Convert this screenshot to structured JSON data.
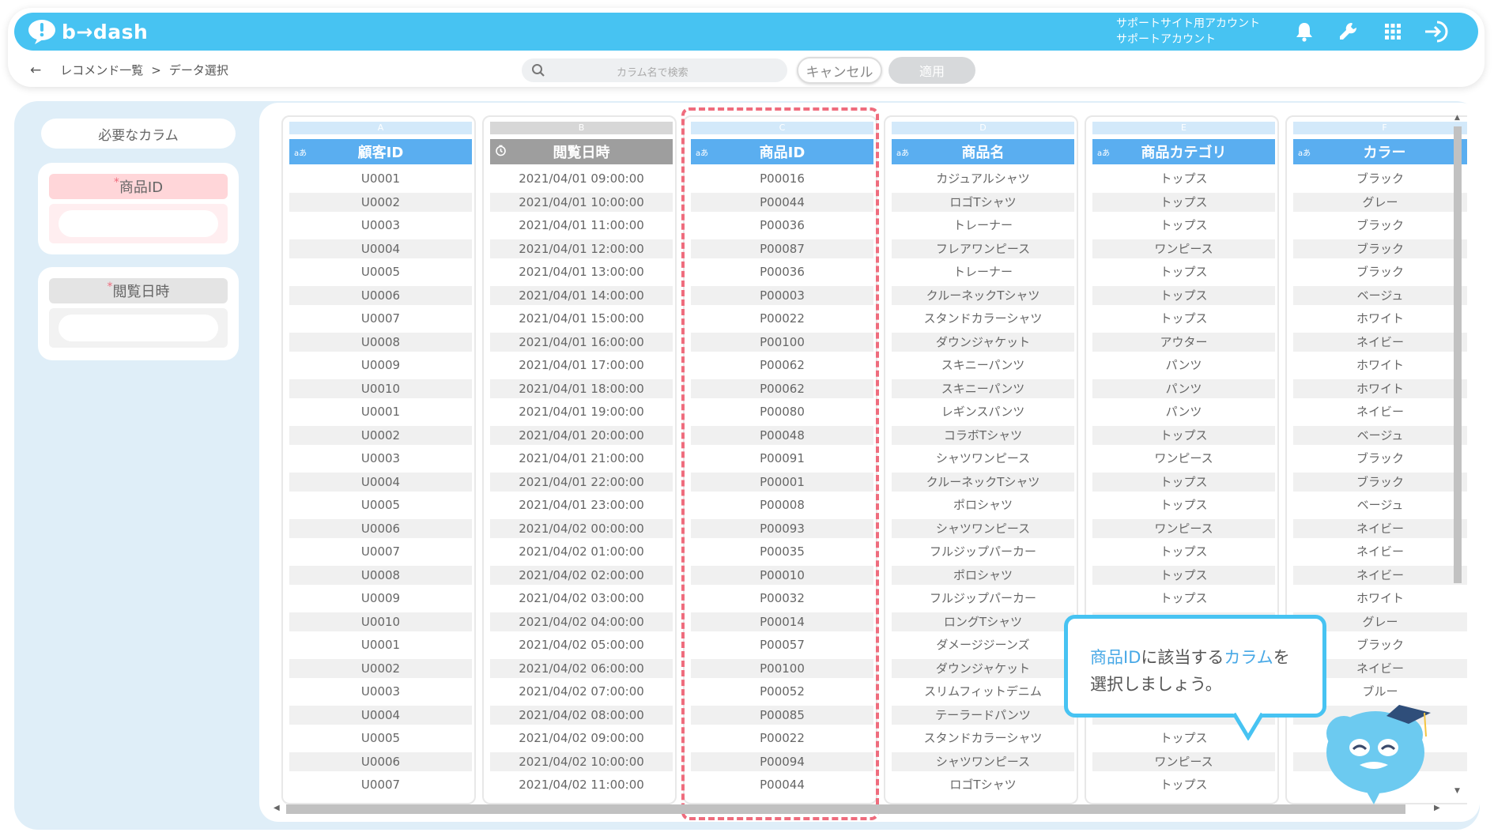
{
  "app": {
    "logo_text": "b→dash",
    "account_line1": "サポートサイト用アカウント",
    "account_line2": "サポートアカウント"
  },
  "toolbar_icons": [
    "bell-icon",
    "wrench-icon",
    "grid-icon",
    "logout-icon"
  ],
  "breadcrumb": {
    "parent": "レコメンド一覧",
    "separator": ">",
    "current": "データ選択"
  },
  "search": {
    "placeholder": "カラム名で検索"
  },
  "buttons": {
    "cancel": "キャンセル",
    "apply": "適用"
  },
  "sidebar": {
    "title": "必要なカラム",
    "required": [
      {
        "label": "商品ID",
        "asterisk": "*",
        "color": "#ffd6d9",
        "slot_color": "#ffeef0",
        "label_color": "#666"
      },
      {
        "label": "閲覧日時",
        "asterisk": "*",
        "color": "#e4e4e4",
        "slot_color": "#f2f2f2",
        "label_color": "#666"
      }
    ]
  },
  "colors": {
    "accent": "#47c3f2",
    "header_blue": "#5aaef0",
    "header_gray": "#9e9e9e",
    "highlight": "#ef6c7d"
  },
  "columns": [
    {
      "letter": "A",
      "name": "顧客ID",
      "type": "aあ",
      "header_color": "#5aaef0",
      "letter_color": "#d3e9fa",
      "values": [
        "U0001",
        "U0002",
        "U0003",
        "U0004",
        "U0005",
        "U0006",
        "U0007",
        "U0008",
        "U0009",
        "U0010",
        "U0001",
        "U0002",
        "U0003",
        "U0004",
        "U0005",
        "U0006",
        "U0007",
        "U0008",
        "U0009",
        "U0010",
        "U0001",
        "U0002",
        "U0003",
        "U0004",
        "U0005",
        "U0006",
        "U0007"
      ]
    },
    {
      "letter": "B",
      "name": "閲覧日時",
      "type": "clock",
      "header_color": "#9e9e9e",
      "letter_color": "#d7d7d7",
      "values": [
        "2021/04/01 09:00:00",
        "2021/04/01 10:00:00",
        "2021/04/01 11:00:00",
        "2021/04/01 12:00:00",
        "2021/04/01 13:00:00",
        "2021/04/01 14:00:00",
        "2021/04/01 15:00:00",
        "2021/04/01 16:00:00",
        "2021/04/01 17:00:00",
        "2021/04/01 18:00:00",
        "2021/04/01 19:00:00",
        "2021/04/01 20:00:00",
        "2021/04/01 21:00:00",
        "2021/04/01 22:00:00",
        "2021/04/01 23:00:00",
        "2021/04/02 00:00:00",
        "2021/04/02 01:00:00",
        "2021/04/02 02:00:00",
        "2021/04/02 03:00:00",
        "2021/04/02 04:00:00",
        "2021/04/02 05:00:00",
        "2021/04/02 06:00:00",
        "2021/04/02 07:00:00",
        "2021/04/02 08:00:00",
        "2021/04/02 09:00:00",
        "2021/04/02 10:00:00",
        "2021/04/02 11:00:00"
      ]
    },
    {
      "letter": "C",
      "name": "商品ID",
      "type": "aあ",
      "header_color": "#5aaef0",
      "letter_color": "#d3e9fa",
      "values": [
        "P00016",
        "P00044",
        "P00036",
        "P00087",
        "P00036",
        "P00003",
        "P00022",
        "P00100",
        "P00062",
        "P00062",
        "P00080",
        "P00048",
        "P00091",
        "P00001",
        "P00008",
        "P00093",
        "P00035",
        "P00010",
        "P00032",
        "P00014",
        "P00057",
        "P00100",
        "P00052",
        "P00085",
        "P00022",
        "P00094",
        "P00044"
      ]
    },
    {
      "letter": "D",
      "name": "商品名",
      "type": "aあ",
      "header_color": "#5aaef0",
      "letter_color": "#d3e9fa",
      "values": [
        "カジュアルシャツ",
        "ロゴTシャツ",
        "トレーナー",
        "フレアワンピース",
        "トレーナー",
        "クルーネックTシャツ",
        "スタンドカラーシャツ",
        "ダウンジャケット",
        "スキニーパンツ",
        "スキニーパンツ",
        "レギンスパンツ",
        "コラボTシャツ",
        "シャツワンピース",
        "クルーネックTシャツ",
        "ポロシャツ",
        "シャツワンピース",
        "フルジップパーカー",
        "ポロシャツ",
        "フルジップパーカー",
        "ロングTシャツ",
        "ダメージジーンズ",
        "ダウンジャケット",
        "スリムフィットデニム",
        "テーラードパンツ",
        "スタンドカラーシャツ",
        "シャツワンピース",
        "ロゴTシャツ"
      ]
    },
    {
      "letter": "E",
      "name": "商品カテゴリ",
      "type": "aあ",
      "header_color": "#5aaef0",
      "letter_color": "#d3e9fa",
      "values": [
        "トップス",
        "トップス",
        "トップス",
        "ワンピース",
        "トップス",
        "トップス",
        "トップス",
        "アウター",
        "パンツ",
        "パンツ",
        "パンツ",
        "トップス",
        "ワンピース",
        "トップス",
        "トップス",
        "ワンピース",
        "トップス",
        "トップス",
        "トップス",
        "",
        "",
        "",
        "",
        "",
        "トップス",
        "ワンピース",
        "トップス"
      ]
    },
    {
      "letter": "F",
      "name": "カラー",
      "type": "aあ",
      "header_color": "#5aaef0",
      "letter_color": "#d3e9fa",
      "values": [
        "ブラック",
        "グレー",
        "ブラック",
        "ブラック",
        "ブラック",
        "ベージュ",
        "ホワイト",
        "ネイビー",
        "ホワイト",
        "ホワイト",
        "ネイビー",
        "ベージュ",
        "ブラック",
        "ブラック",
        "ベージュ",
        "ネイビー",
        "ネイビー",
        "ネイビー",
        "ホワイト",
        "グレー",
        "ブラック",
        "ネイビー",
        "ブルー",
        "",
        "",
        "",
        ""
      ]
    }
  ],
  "tooltip": {
    "part1": "商品ID",
    "part2": "に該当する",
    "part3": "カラム",
    "part4": "を",
    "line2": "選択しましょう。"
  }
}
